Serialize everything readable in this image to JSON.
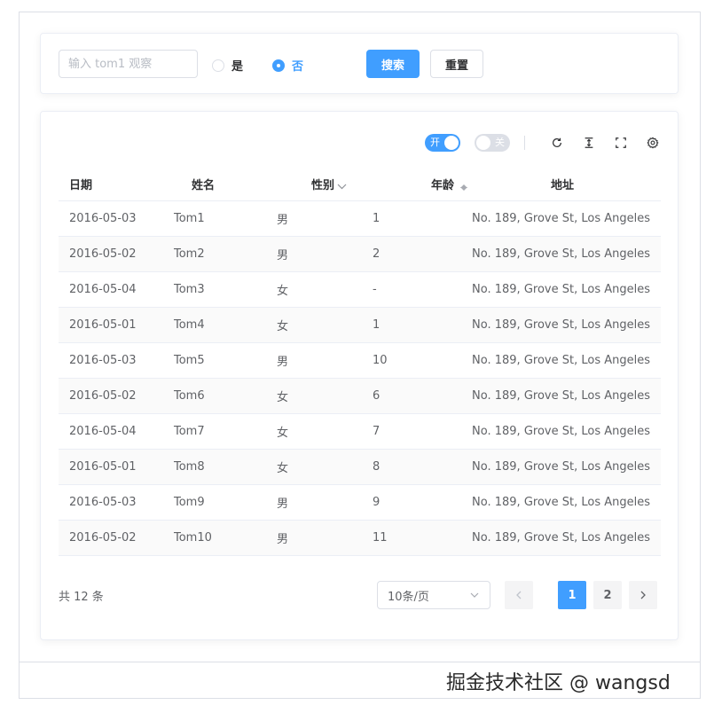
{
  "search": {
    "placeholder": "输入 tom1 观察",
    "value": "",
    "radio_yes": "是",
    "radio_no": "否",
    "selected": "否",
    "search_button": "搜索",
    "reset_button": "重置"
  },
  "toolbar": {
    "switch_on_label": "开",
    "switch_off_label": "关",
    "switch_on_state": true,
    "switch_off_state": false
  },
  "table": {
    "headers": [
      "日期",
      "姓名",
      "性别",
      "年龄",
      "地址"
    ],
    "rows": [
      {
        "date": "2016-05-03",
        "name": "Tom1",
        "gender": "男",
        "age": "1",
        "address": "No. 189, Grove St, Los Angeles"
      },
      {
        "date": "2016-05-02",
        "name": "Tom2",
        "gender": "男",
        "age": "2",
        "address": "No. 189, Grove St, Los Angeles"
      },
      {
        "date": "2016-05-04",
        "name": "Tom3",
        "gender": "女",
        "age": "-",
        "address": "No. 189, Grove St, Los Angeles"
      },
      {
        "date": "2016-05-01",
        "name": "Tom4",
        "gender": "女",
        "age": "1",
        "address": "No. 189, Grove St, Los Angeles"
      },
      {
        "date": "2016-05-03",
        "name": "Tom5",
        "gender": "男",
        "age": "10",
        "address": "No. 189, Grove St, Los Angeles"
      },
      {
        "date": "2016-05-02",
        "name": "Tom6",
        "gender": "女",
        "age": "6",
        "address": "No. 189, Grove St, Los Angeles"
      },
      {
        "date": "2016-05-04",
        "name": "Tom7",
        "gender": "女",
        "age": "7",
        "address": "No. 189, Grove St, Los Angeles"
      },
      {
        "date": "2016-05-01",
        "name": "Tom8",
        "gender": "女",
        "age": "8",
        "address": "No. 189, Grove St, Los Angeles"
      },
      {
        "date": "2016-05-03",
        "name": "Tom9",
        "gender": "男",
        "age": "9",
        "address": "No. 189, Grove St, Los Angeles"
      },
      {
        "date": "2016-05-02",
        "name": "Tom10",
        "gender": "男",
        "age": "11",
        "address": "No. 189, Grove St, Los Angeles"
      }
    ]
  },
  "pagination": {
    "total": "共 12 条",
    "page_size": "10条/页",
    "pages": [
      "1",
      "2"
    ],
    "current": "1"
  },
  "watermark": "掘金技术社区 @ wangsd",
  "colors": {
    "primary": "#409eff",
    "border": "#dcdfe6",
    "text": "#606266",
    "heading": "#303133"
  }
}
